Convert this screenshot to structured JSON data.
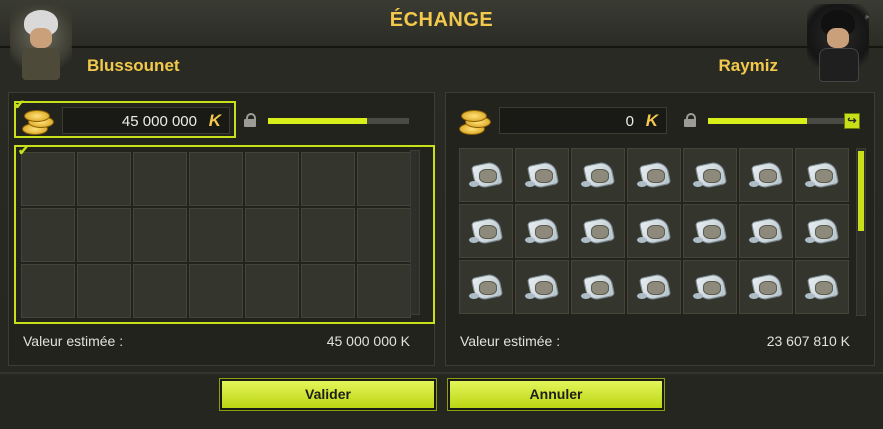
{
  "window": {
    "title": "ÉCHANGE",
    "close_symbol": "✕"
  },
  "left_player": {
    "name": "Blussounet",
    "kamas_value": "45 000 000",
    "kamas_symbol": "K",
    "progress": 0.7,
    "estimated_label": "Valeur estimée :",
    "estimated_value": "45 000 000 K",
    "grid_rows": 3,
    "grid_cols": 7,
    "items": []
  },
  "right_player": {
    "name": "Raymiz",
    "kamas_value": "0",
    "kamas_symbol": "K",
    "progress": 0.7,
    "estimated_label": "Valeur estimée :",
    "estimated_value": "23 607 810 K",
    "grid_rows": 3,
    "grid_cols": 7,
    "item_icon": "scroll-item-icon",
    "filled_cells": 21
  },
  "buttons": {
    "validate_label": "Valider",
    "cancel_label": "Annuler"
  },
  "colors": {
    "accent": "#c8e01a",
    "title": "#f2c94c",
    "background": "#25261f"
  }
}
